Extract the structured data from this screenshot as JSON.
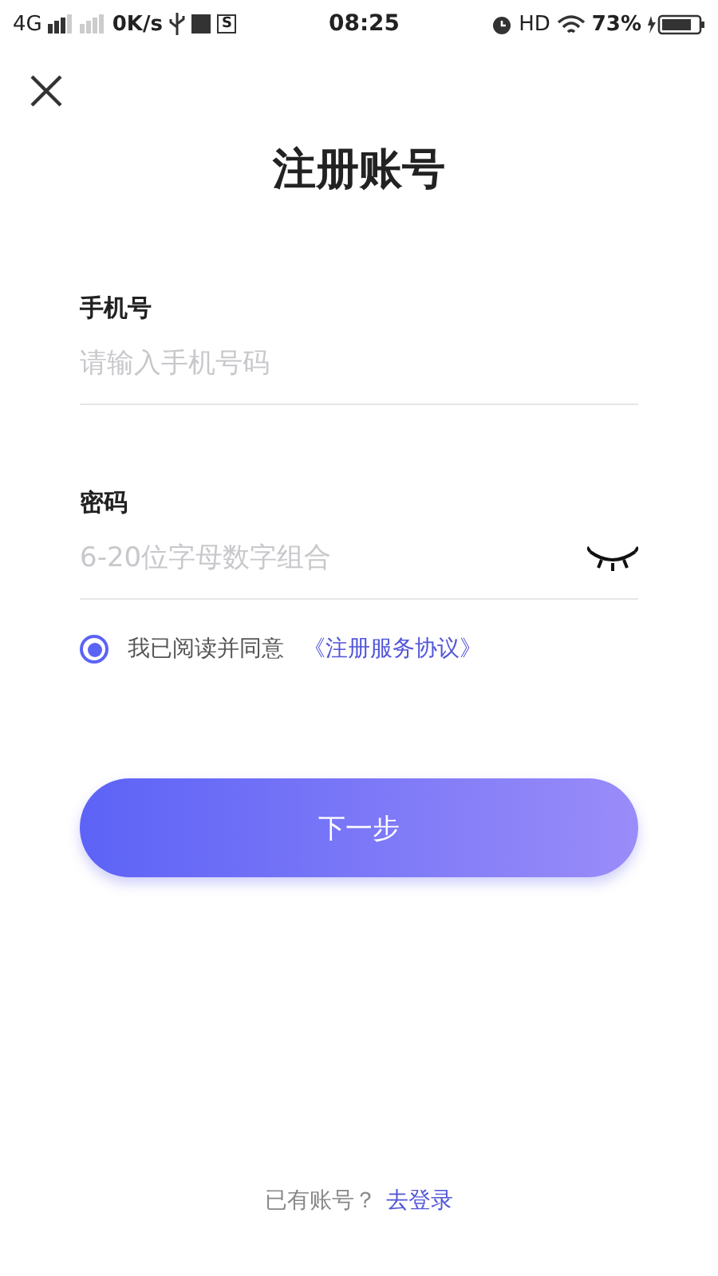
{
  "status_bar": {
    "network": "4G",
    "speed": "0K/s",
    "sim_box": "S",
    "time": "08:25",
    "hd": "HD",
    "battery": "73%"
  },
  "title": "注册账号",
  "fields": [
    {
      "label": "手机号",
      "placeholder": "请输入手机号码",
      "kind": "phone"
    },
    {
      "label": "密码",
      "placeholder": "6-20位字母数字组合",
      "kind": "password",
      "password_visible": false
    }
  ],
  "agreement": {
    "checked": true,
    "text": "我已阅读并同意",
    "link": "《注册服务协议》"
  },
  "next_button": "下一步",
  "footer": {
    "text": "已有账号？",
    "link": "去登录"
  }
}
